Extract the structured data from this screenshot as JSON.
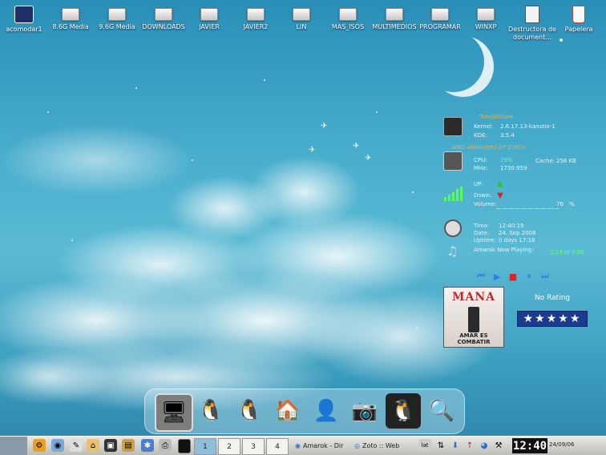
{
  "desktop_icons": [
    {
      "label": "acomodar1",
      "icon": "kde-drive-icon"
    },
    {
      "label": "8.6G Media",
      "icon": "hard-drive-icon"
    },
    {
      "label": "9.6G Media",
      "icon": "hard-drive-icon"
    },
    {
      "label": "DOWNLOADS",
      "icon": "hard-drive-icon"
    },
    {
      "label": "JAVIER",
      "icon": "hard-drive-icon"
    },
    {
      "label": "JAVIER2",
      "icon": "hard-drive-icon"
    },
    {
      "label": "LIN",
      "icon": "hard-drive-icon"
    },
    {
      "label": "MAS_ISOS",
      "icon": "hard-drive-icon"
    },
    {
      "label": "MULTIMEDIOS",
      "icon": "hard-drive-icon"
    },
    {
      "label": "PROGRAMAR",
      "icon": "hard-drive-icon"
    },
    {
      "label": "WINXP",
      "icon": "hard-drive-icon"
    },
    {
      "label": "Destructora de document...",
      "icon": "shredder-icon"
    },
    {
      "label": "Papelera",
      "icon": "trash-icon"
    }
  ],
  "system": {
    "user": "Toto@Alizee",
    "kernel_label": "Kernel:",
    "kernel": "2.6.17.13-kanotix-1",
    "kde_label": "KDE:",
    "kde": "3.5.4",
    "cpu_name": "AMD Athlon(tm) XP 2100+",
    "cpu_label": "CPU:",
    "cpu": "29%",
    "cache_label": "Cache:",
    "cache": "256 KB",
    "mhz_label": "MHz:",
    "mhz": "1730.959",
    "up_label": "UP:",
    "down_label": "Down:",
    "volume_label": "Volume:",
    "volume": "76",
    "volume_unit": "%",
    "time_label": "Time:",
    "time": "12:40:19",
    "date_label": "Date:",
    "date": "24. Sep 2006",
    "uptime_label": "Uptime:",
    "uptime": "0 days 17:16",
    "amarok_label": "Amarok Now Playing:",
    "track_pos": "2:13 of 4:50"
  },
  "album": {
    "artist": "MANA",
    "title": "AMAR ES COMBATIR",
    "rating_label": "No Rating",
    "stars": "★★★★★"
  },
  "player_buttons": [
    "prev",
    "play",
    "stop",
    "pause",
    "next"
  ],
  "dock_items": [
    "monitor-icon",
    "flame-tux-icon",
    "mail-tux-icon",
    "home-icon",
    "messenger-icon",
    "camera-tux-icon",
    "game-tux-icon",
    "search-tux-icon"
  ],
  "taskbar": {
    "desktops": [
      "1",
      "2",
      "3",
      "4"
    ],
    "tasks": [
      "Amarok - Dir",
      "Zoto :: Web"
    ],
    "clock": "12:40",
    "date": "24/09/06"
  },
  "colors": {
    "accent_orange": "#f0b040",
    "accent_green": "#6cff6c",
    "star_bg": "#1a3b8f"
  }
}
